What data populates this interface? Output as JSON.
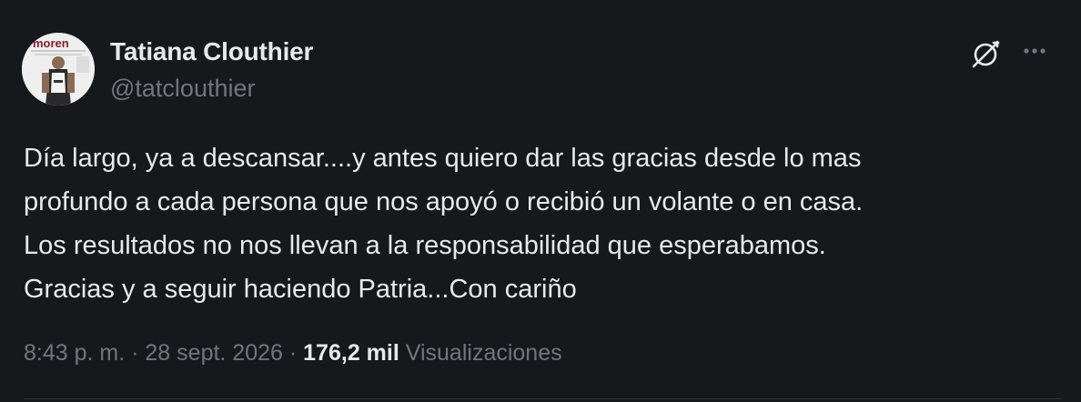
{
  "author": {
    "name": "Tatiana Clouthier",
    "handle": "@tatclouthier",
    "avatar_text": "moren"
  },
  "tweet": {
    "lines": [
      "Día largo, ya a descansar....y antes quiero dar las gracias desde lo mas",
      "profundo a cada persona que nos apoyó o recibió un volante o en casa.",
      "Los resultados no nos llevan a la responsabilidad que esperabamos.",
      "Gracias y a seguir haciendo Patria...Con cariño"
    ]
  },
  "meta": {
    "time": "8:43 p. m.",
    "separator": "·",
    "date": "28 sept. 2026",
    "views_count": "176,2 mil",
    "views_label": "Visualizaciones"
  },
  "icons": {
    "grok": "grok-icon",
    "more": "more-icon"
  },
  "colors": {
    "background": "#16181c",
    "text_primary": "#e7e9ea",
    "text_secondary": "#71767b",
    "brand_morena": "#8a1d2c"
  }
}
